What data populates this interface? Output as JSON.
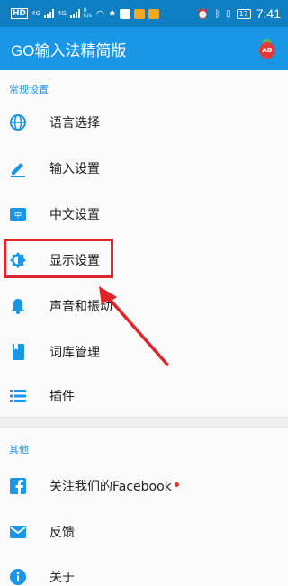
{
  "status_bar": {
    "carrier_left": "HD",
    "network_1": "4G",
    "network_2": "4G",
    "speed": "0 K/s",
    "battery": "17",
    "time": "7:41"
  },
  "app_bar": {
    "title": "GO输入法精简版",
    "ad_badge": "AD"
  },
  "sections": {
    "general_header": "常规设置",
    "other_header": "其他"
  },
  "general_items": [
    {
      "label": "语言选择",
      "icon": "globe-icon"
    },
    {
      "label": "输入设置",
      "icon": "pencil-icon"
    },
    {
      "label": "中文设置",
      "icon": "chinese-keyboard-icon"
    },
    {
      "label": "显示设置",
      "icon": "brightness-icon"
    },
    {
      "label": "声音和振动",
      "icon": "bell-icon"
    },
    {
      "label": "词库管理",
      "icon": "book-icon"
    },
    {
      "label": "插件",
      "icon": "list-icon"
    }
  ],
  "other_items": [
    {
      "label": "关注我们的Facebook",
      "icon": "facebook-icon"
    },
    {
      "label": "反馈",
      "icon": "mail-icon"
    },
    {
      "label": "关于",
      "icon": "info-icon"
    }
  ],
  "colors": {
    "status_bar": "#0f7fc4",
    "app_bar": "#1a96e6",
    "icon_blue": "#1a96e6",
    "highlight": "#e0252a"
  }
}
